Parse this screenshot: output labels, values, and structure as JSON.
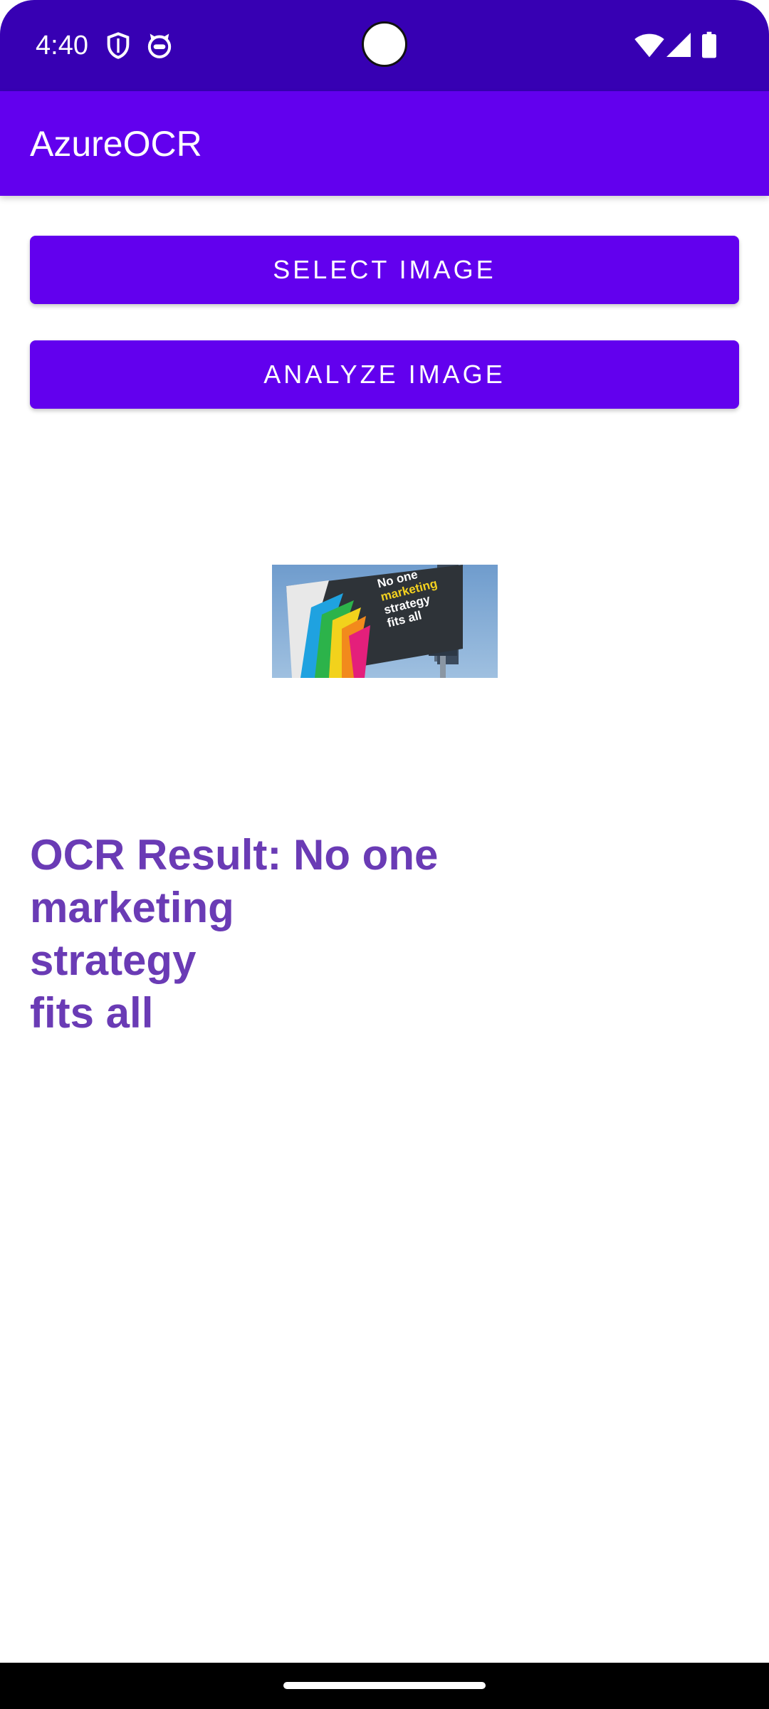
{
  "status_bar": {
    "time": "4:40",
    "left_icons": [
      "shield-icon",
      "cat-face-icon"
    ],
    "right_icons": [
      "wifi-icon",
      "cell-signal-icon",
      "battery-icon"
    ],
    "background": "#3700b3"
  },
  "app_bar": {
    "title": "AzureOCR",
    "background": "#6200ee"
  },
  "buttons": {
    "select_label": "SELECT IMAGE",
    "analyze_label": "ANALYZE IMAGE"
  },
  "preview": {
    "billboard_lines": [
      "No one",
      "marketing",
      "strategy",
      "fits all"
    ],
    "highlight_color": "#f4d21f"
  },
  "result": {
    "text": "OCR Result: No one\nmarketing\nstrategy\nfits all",
    "color": "#6a3bb5"
  }
}
